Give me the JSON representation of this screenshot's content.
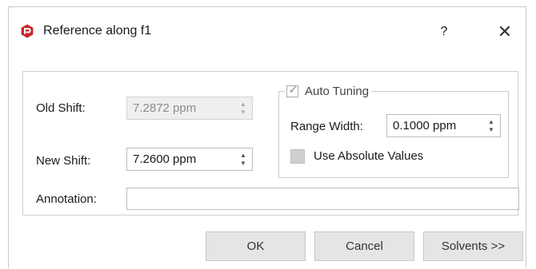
{
  "window": {
    "title": "Reference along f1",
    "help_label": "?",
    "close_label": "✕",
    "icon": "app-logo-icon",
    "accent_color": "#c8282f"
  },
  "form": {
    "old_shift": {
      "label": "Old Shift:",
      "value": "7.2872 ppm",
      "disabled": true
    },
    "new_shift": {
      "label": "New Shift:",
      "value": "7.2600 ppm"
    },
    "annotation": {
      "label": "Annotation:",
      "value": ""
    }
  },
  "auto_tuning": {
    "label": "Auto Tuning",
    "checked": true,
    "range_width": {
      "label": "Range Width:",
      "value": "0.1000 ppm"
    },
    "use_absolute_values": {
      "label": "Use Absolute Values",
      "checked": false
    }
  },
  "buttons": {
    "ok": "OK",
    "cancel": "Cancel",
    "solvents": "Solvents >>"
  }
}
